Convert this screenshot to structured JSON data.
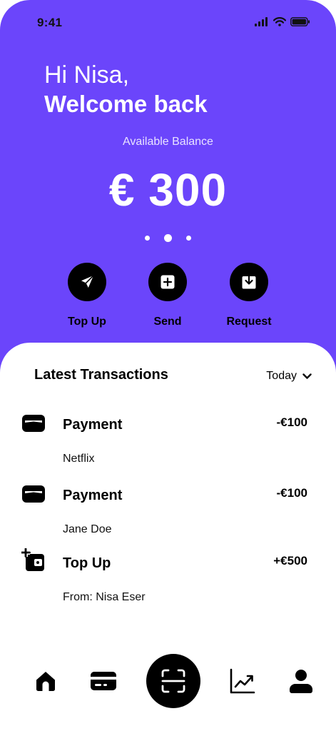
{
  "status_bar": {
    "time": "9:41"
  },
  "header": {
    "greeting": "Hi Nisa,",
    "welcome": "Welcome back",
    "balance_label": "Available Balance",
    "balance": "€ 300"
  },
  "carousel": {
    "count": 3,
    "active_index": 1
  },
  "actions": [
    {
      "label": "Top Up",
      "icon": "send-arrow-icon"
    },
    {
      "label": "Send",
      "icon": "plus-square-icon"
    },
    {
      "label": "Request",
      "icon": "download-icon"
    }
  ],
  "transactions_section": {
    "title": "Latest Transactions",
    "filter": "Today"
  },
  "transactions": [
    {
      "title": "Payment",
      "subtitle": "Netflix",
      "amount": "-€100",
      "icon": "wallet-icon"
    },
    {
      "title": "Payment",
      "subtitle": "Jane Doe",
      "amount": "-€100",
      "icon": "wallet-icon"
    },
    {
      "title": "Top Up",
      "subtitle": "From: Nisa Eser",
      "amount": "+€500",
      "icon": "wallet-add-icon"
    }
  ],
  "bottom_nav": [
    {
      "icon": "home-icon"
    },
    {
      "icon": "card-icon"
    },
    {
      "icon": "scan-icon"
    },
    {
      "icon": "chart-icon"
    },
    {
      "icon": "profile-icon"
    }
  ],
  "colors": {
    "accent": "#6b45fb",
    "sheet": "#ffffff",
    "button": "#000000"
  }
}
